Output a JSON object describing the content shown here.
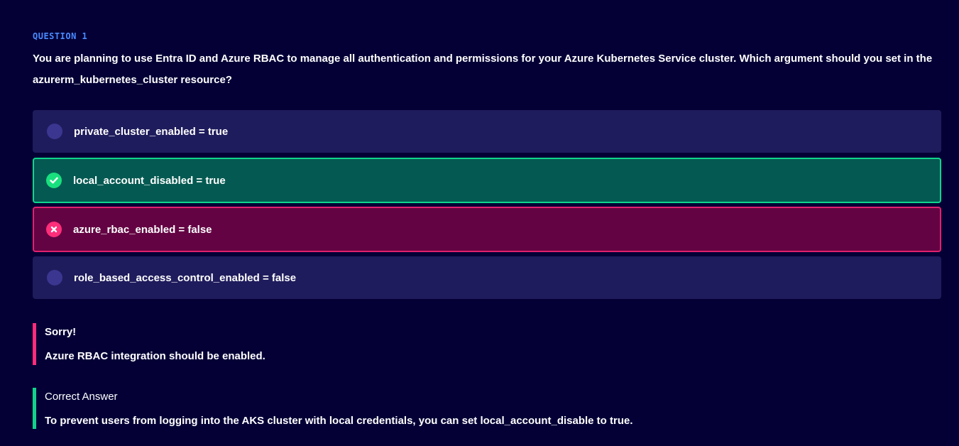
{
  "question": {
    "label": "QUESTION 1",
    "text": "You are planning to use Entra ID and Azure RBAC to manage all authentication and permissions for your Azure Kubernetes Service cluster. Which argument should you set in the azurerm_kubernetes_cluster resource?"
  },
  "options": [
    {
      "label": "private_cluster_enabled = true",
      "state": "neutral"
    },
    {
      "label": "local_account_disabled = true",
      "state": "correct",
      "icon": "check-icon"
    },
    {
      "label": "azure_rbac_enabled = false",
      "state": "wrong",
      "icon": "cross-icon"
    },
    {
      "label": "role_based_access_control_enabled = false",
      "state": "neutral"
    }
  ],
  "feedback": {
    "sorry_title": "Sorry!",
    "sorry_text": "Azure RBAC integration should be enabled.",
    "answer_title": "Correct Answer",
    "answer_text": "To prevent users from logging into the AKS cluster with local credentials, you can set local_account_disable to true."
  },
  "colors": {
    "background": "#040036",
    "question_label": "#4a8cff",
    "option_bg": "#1f1c5d",
    "correct_bg": "#045a52",
    "correct_border": "#0fd58b",
    "wrong_bg": "#640343",
    "wrong_border": "#e0216d"
  }
}
